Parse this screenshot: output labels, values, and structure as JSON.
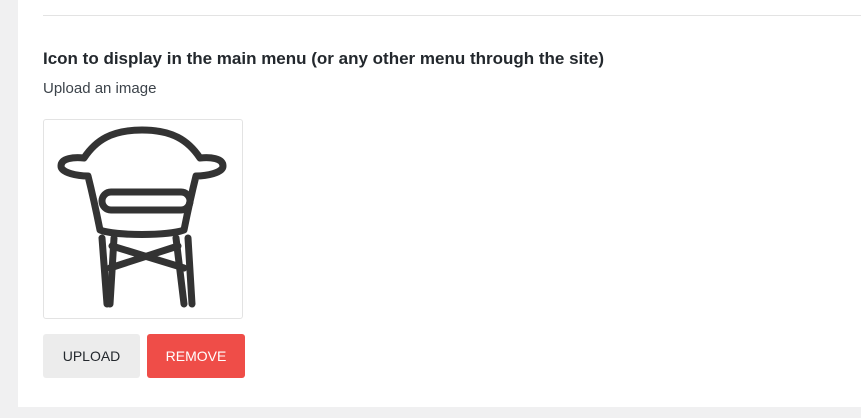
{
  "field": {
    "title": "Icon to display in the main menu (or any other menu through the site)",
    "subtitle": "Upload an image"
  },
  "preview": {
    "icon": "chair-icon"
  },
  "buttons": {
    "upload_label": "UPLOAD",
    "remove_label": "REMOVE"
  },
  "colors": {
    "remove_button": "#ef4d48",
    "upload_button": "#ececec",
    "icon_stroke": "#333333"
  }
}
